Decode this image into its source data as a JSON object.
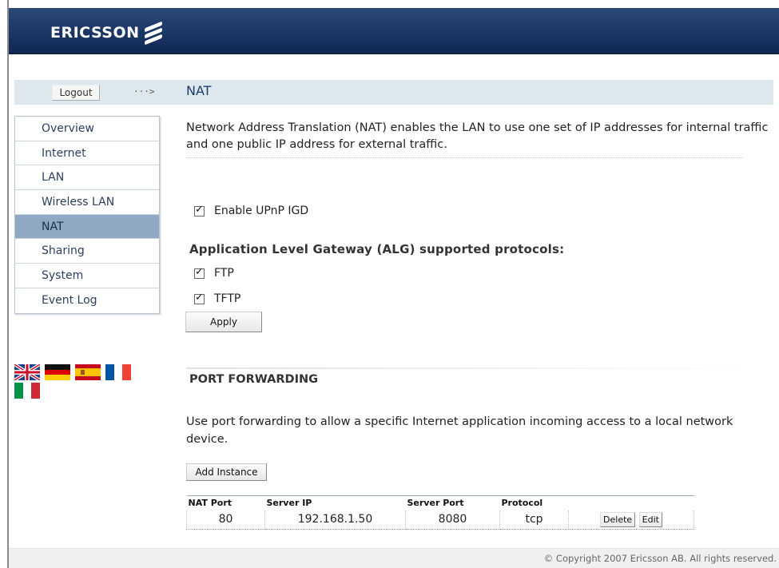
{
  "header": {
    "logo_text": "ERICSSON"
  },
  "topbar": {
    "logout_label": "Logout",
    "arrow": "···>",
    "page_title": "NAT"
  },
  "menu": {
    "items": [
      {
        "label": "Overview",
        "active": false
      },
      {
        "label": "Internet",
        "active": false
      },
      {
        "label": "LAN",
        "active": false
      },
      {
        "label": "Wireless LAN",
        "active": false
      },
      {
        "label": "NAT",
        "active": true
      },
      {
        "label": "Sharing",
        "active": false
      },
      {
        "label": "System",
        "active": false
      },
      {
        "label": "Event Log",
        "active": false
      }
    ]
  },
  "languages": [
    "English",
    "German",
    "Spanish",
    "French",
    "Italian"
  ],
  "nat": {
    "description": "Network Address Translation (NAT) enables the LAN to use one set of IP addresses for internal traffic and one public IP address for external traffic.",
    "upnp_label": "Enable UPnP IGD",
    "upnp_checked": true,
    "alg_title": "Application Level Gateway (ALG) supported protocols:",
    "alg_protocols": [
      {
        "label": "FTP",
        "checked": true
      },
      {
        "label": "TFTP",
        "checked": true
      }
    ],
    "apply_label": "Apply"
  },
  "port_forwarding": {
    "title": "PORT FORWARDING",
    "description": "Use port forwarding to allow a specific Internet application incoming access to a local network device.",
    "add_label": "Add Instance",
    "columns": [
      "NAT Port",
      "Server IP",
      "Server Port",
      "Protocol",
      ""
    ],
    "rows": [
      {
        "nat_port": "80",
        "server_ip": "192.168.1.50",
        "server_port": "8080",
        "protocol": "tcp"
      }
    ],
    "delete_label": "Delete",
    "edit_label": "Edit"
  },
  "footer": {
    "copyright": "© Copyright 2007 Ericsson AB. All rights reserved."
  },
  "colors": {
    "header_bg": "#1a3462",
    "menu_active": "#8fa9c4",
    "title_blue": "#1f3c6a",
    "bar_bg": "#dde8ee"
  }
}
